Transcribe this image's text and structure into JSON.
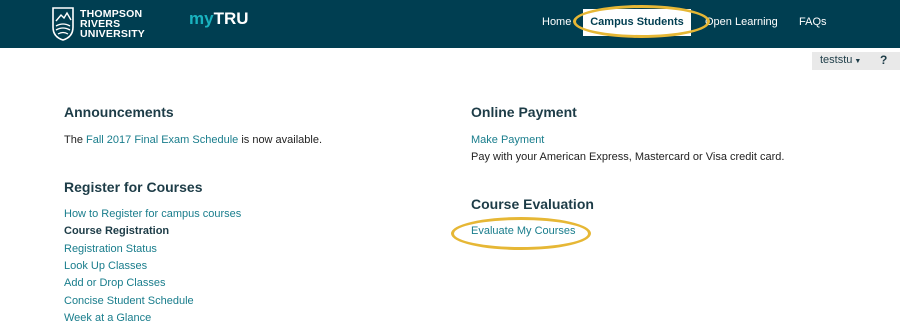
{
  "brand": {
    "university_lines": [
      "THOMPSON",
      "RIVERS",
      "UNIVERSITY"
    ],
    "app_name_prefix": "my",
    "app_name_suffix": "TRU"
  },
  "nav": {
    "items": [
      {
        "label": "Home"
      },
      {
        "label": "Campus Students",
        "active": true
      },
      {
        "label": "Open Learning"
      },
      {
        "label": "FAQs"
      }
    ]
  },
  "user": {
    "username": "teststu",
    "help_label": "?"
  },
  "announcements": {
    "heading": "Announcements",
    "text_before": "The ",
    "link": "Fall 2017 Final Exam Schedule",
    "text_after": " is now available."
  },
  "register": {
    "heading": "Register for Courses",
    "links": [
      "How to Register for campus courses",
      "Course Registration",
      "Registration Status",
      "Look Up Classes",
      "Add or Drop Classes",
      "Concise Student Schedule",
      "Week at a Glance"
    ]
  },
  "payment": {
    "heading": "Online Payment",
    "link": "Make Payment",
    "description": "Pay with your American Express, Mastercard or Visa credit card."
  },
  "evaluation": {
    "heading": "Course Evaluation",
    "link": "Evaluate My Courses"
  },
  "colors": {
    "topbar": "#003e51",
    "link": "#197d8c",
    "highlight_ring": "#e6b735"
  }
}
